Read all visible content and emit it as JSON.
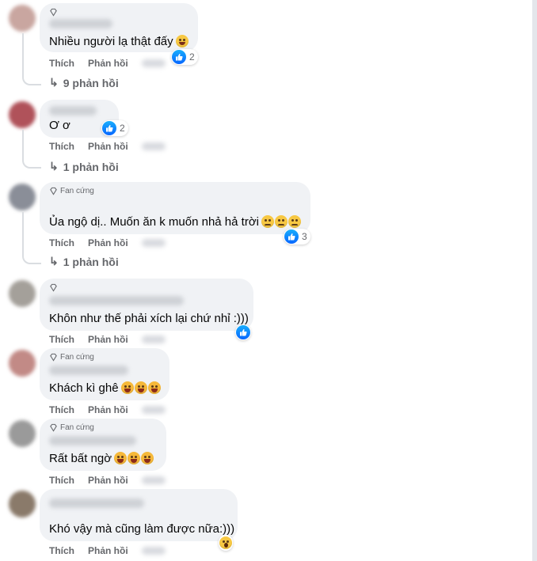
{
  "labels": {
    "like": "Thích",
    "reply": "Phản hồi",
    "fan_badge": "Fan cứng"
  },
  "comments": [
    {
      "text": "Nhiều người lạ thật đấy",
      "reaction_count": "2",
      "replies": "9 phản hồi"
    },
    {
      "text": "Ơ ơ",
      "reaction_count": "2",
      "replies": "1 phản hồi"
    },
    {
      "text": "Ủa ngộ dị.. Muốn ăn k muốn nhả hả trời",
      "reaction_count": "3",
      "replies": "1 phản hồi"
    },
    {
      "text": "Khôn như thế phải xích lại chứ nhỉ :)))"
    },
    {
      "text": "Khách kì ghê"
    },
    {
      "text": "Rất bất ngờ"
    },
    {
      "text": "Khó vậy mà cũng làm được nữa:)))"
    }
  ]
}
